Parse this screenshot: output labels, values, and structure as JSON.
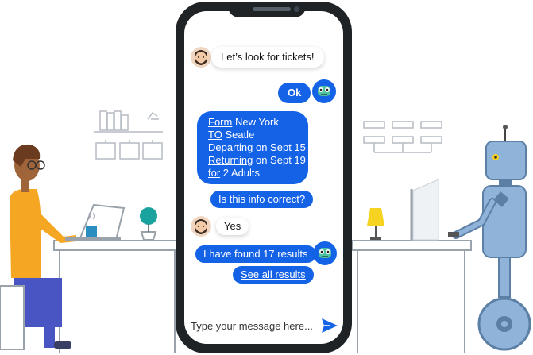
{
  "chat": {
    "messages": [
      {
        "sender": "user",
        "text": "Let’s look for tickets!"
      },
      {
        "sender": "bot",
        "text": "Ok"
      },
      {
        "sender": "bot",
        "lines": [
          {
            "key": "Form",
            "value": " New York"
          },
          {
            "key": "TO",
            "value": " Seatle"
          },
          {
            "key": "Departing",
            "value": " on Sept 15"
          },
          {
            "key": "Returning",
            "value": " on Sept 19"
          },
          {
            "key": "for",
            "value": " 2 Adults"
          }
        ]
      },
      {
        "sender": "bot",
        "text": "Is this info correct?"
      },
      {
        "sender": "user",
        "text": "Yes"
      },
      {
        "sender": "bot",
        "text": "I have found 17 results"
      },
      {
        "sender": "bot",
        "text": "See all results",
        "link": true
      }
    ]
  },
  "composer": {
    "placeholder": "Type your message here...",
    "send_icon": "send-icon"
  },
  "colors": {
    "accent": "#1462e6",
    "phone_frame": "#1f2326",
    "person_shirt": "#f5a623",
    "robot_body": "#8fb3d9"
  },
  "icons": {
    "user_avatar": "bearded-man-avatar",
    "bot_avatar": "robot-face-avatar"
  }
}
